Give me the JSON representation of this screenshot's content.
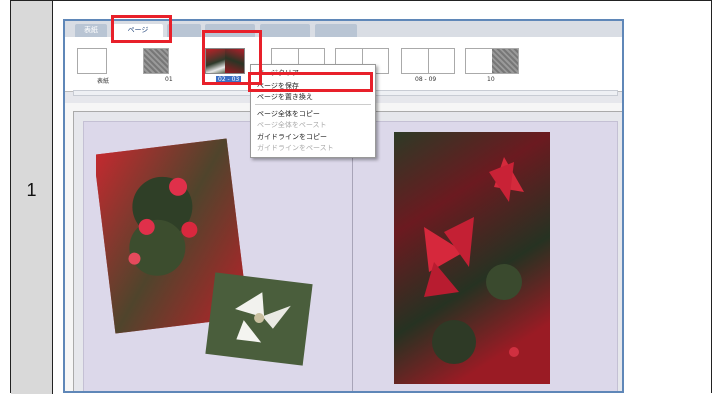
{
  "row": {
    "number": "1"
  },
  "tabs": [
    {
      "label": "表紙",
      "active": false
    },
    {
      "label": "ページ",
      "active": true
    },
    {
      "label": "",
      "active": false
    },
    {
      "label": "",
      "active": false
    },
    {
      "label": "",
      "active": false
    },
    {
      "label": "",
      "active": false
    }
  ],
  "thumbnails": [
    {
      "label": "表紙",
      "selected": false
    },
    {
      "label": "01",
      "selected": false
    },
    {
      "label": "02 - 03",
      "selected": true
    },
    {
      "label": "",
      "selected": false
    },
    {
      "label": "",
      "selected": false
    },
    {
      "label": "08 - 09",
      "selected": false
    },
    {
      "label": "10",
      "selected": false
    }
  ],
  "context_menu": {
    "items": [
      {
        "label": "ページクリア",
        "enabled": true
      },
      {
        "label": "ページを保存",
        "enabled": true
      },
      {
        "label": "ページを置き換え",
        "enabled": true
      },
      {
        "label": "ページ全体をコピー",
        "enabled": true
      },
      {
        "label": "ページ全体をペースト",
        "enabled": false
      },
      {
        "label": "ガイドラインをコピー",
        "enabled": true
      },
      {
        "label": "ガイドラインをペースト",
        "enabled": false
      }
    ]
  },
  "colors": {
    "highlight": "#e8202a",
    "window_border": "#5f87b8",
    "spread_bg": "#dcd8ea",
    "selected_label": "#3b6fc4"
  }
}
